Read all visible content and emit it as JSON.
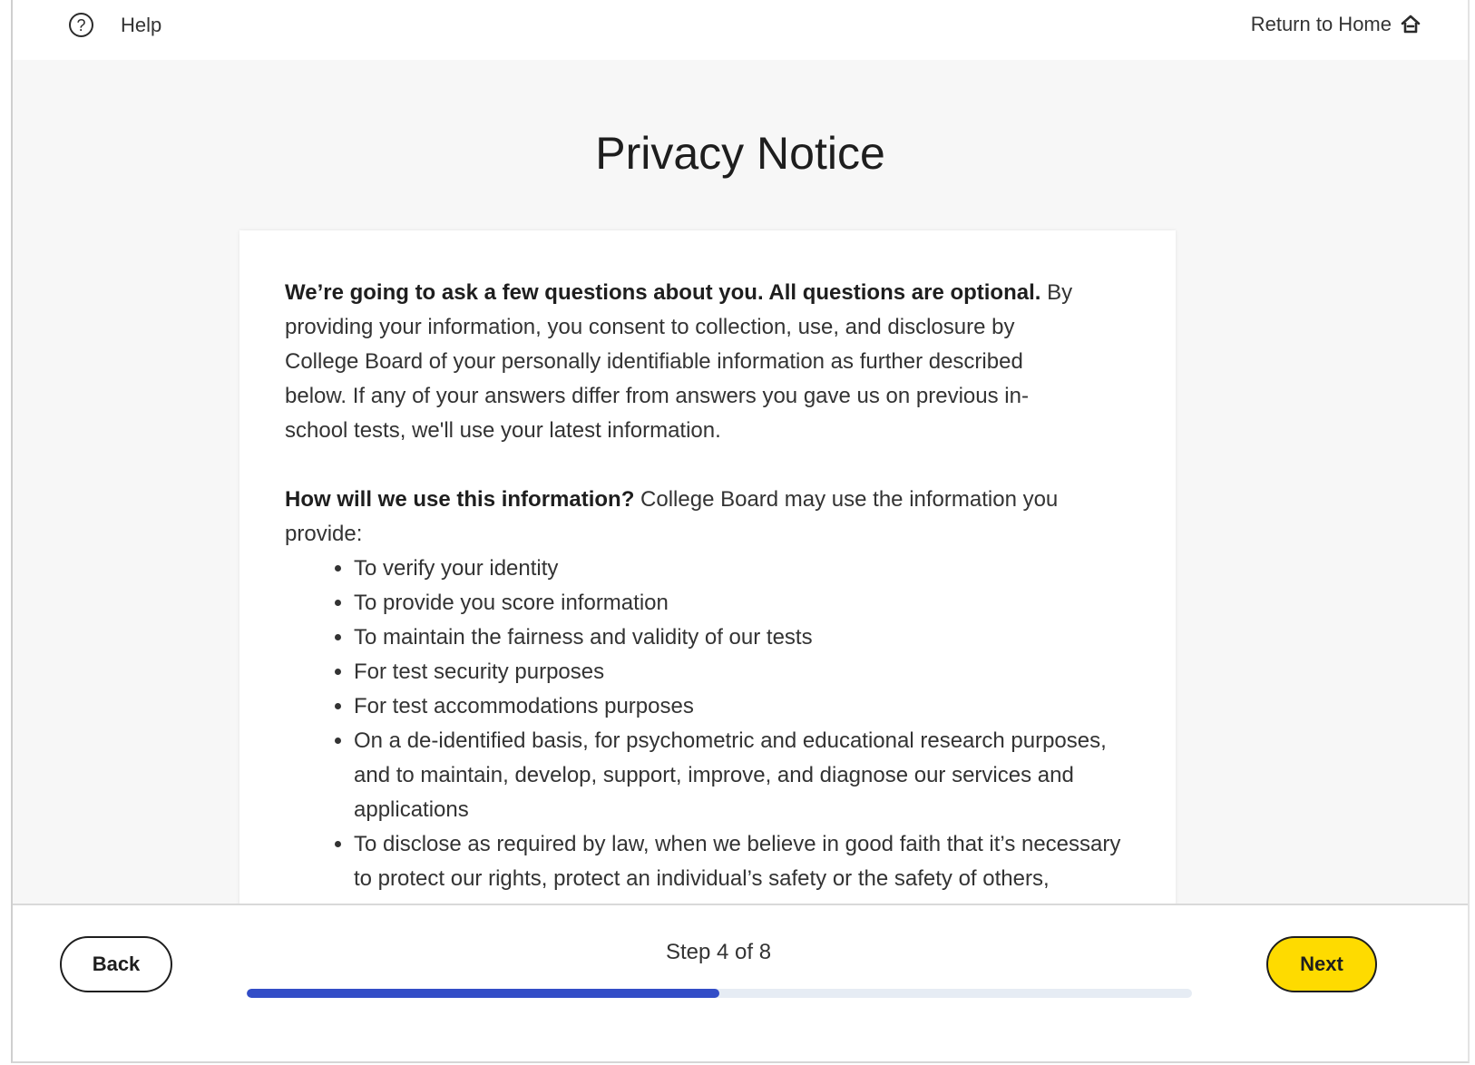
{
  "header": {
    "help_label": "Help",
    "home_label": "Return to Home",
    "help_icon": "question-circle-icon",
    "home_icon": "home-icon"
  },
  "page": {
    "title": "Privacy Notice"
  },
  "notice": {
    "intro_bold": "We’re going to ask a few questions about you. All questions are optional.",
    "intro_text": " By providing your information, you consent to collection, use, and disclosure by College Board of your personally identifiable information as further described below. If any of your answers differ from answers you gave us on previous in-school tests, we'll use your latest information.",
    "use_bold": "How will we use this information?",
    "use_text": " College Board may use the information you provide:",
    "bullets": [
      "To verify your identity",
      "To provide you score information",
      "To maintain the fairness and validity of our tests",
      "For test security purposes",
      "For test accommodations purposes",
      "On a de-identified basis, for psychometric and educational research purposes, and to maintain, develop, support, improve, and diagnose our services and applications",
      "To disclose as required by law, when we believe in good faith that it’s necessary to protect our rights, protect an individual’s safety or the safety of others, investigate fraud, or respond to a government request"
    ]
  },
  "footer": {
    "back_label": "Back",
    "next_label": "Next",
    "step_label": "Step 4 of 8",
    "progress_fraction": 0.5
  },
  "colors": {
    "accent": "#324dc7",
    "next_button": "#fedb00"
  }
}
